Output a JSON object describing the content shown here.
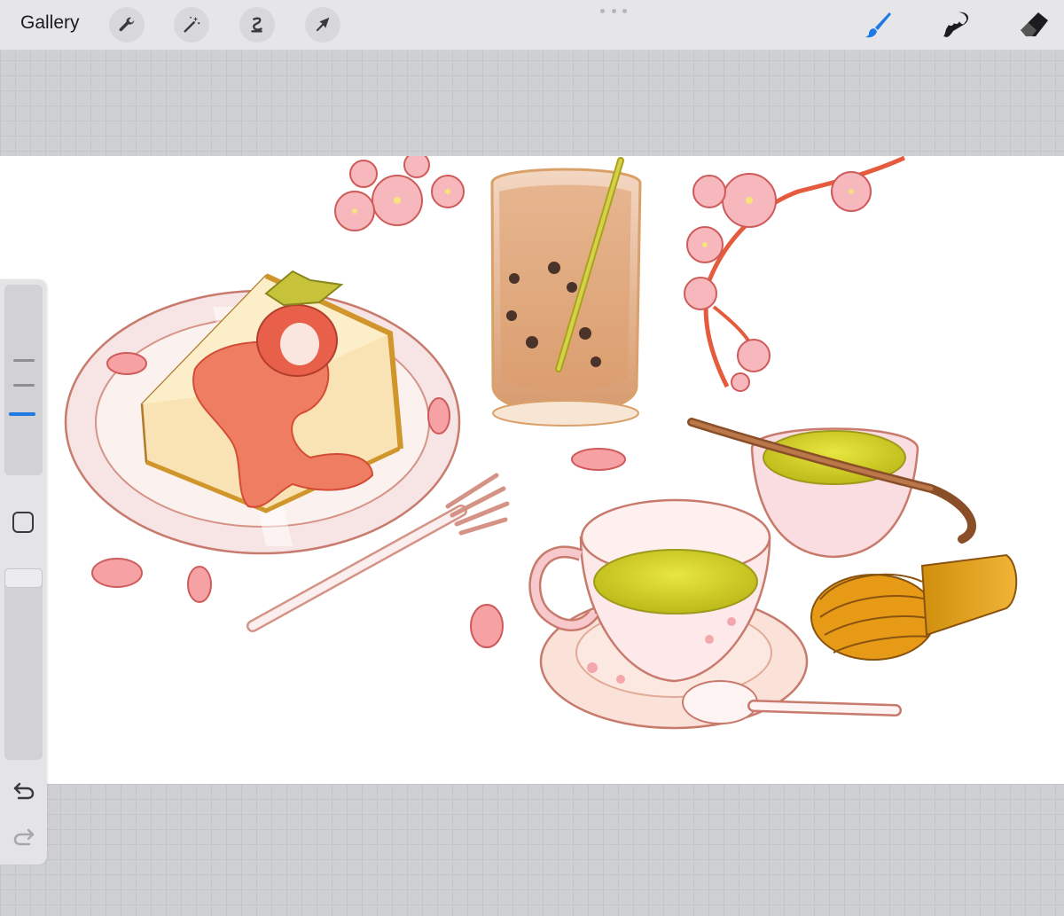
{
  "toolbar": {
    "gallery_label": "Gallery",
    "left_tools": [
      "wrench-icon",
      "magic-wand-icon",
      "selection-icon",
      "transform-arrow-icon"
    ],
    "right_tools": [
      "brush-icon",
      "smudge-icon",
      "eraser-icon"
    ],
    "active_tool": "brush",
    "accent_color": "#1f7ae6"
  },
  "sidebar": {
    "brush_size_level": 0.3,
    "opacity_level": 1.0,
    "buttons": [
      "modify-button",
      "undo-icon",
      "redo-icon"
    ]
  },
  "canvas": {
    "background": "#ffffff",
    "palette": {
      "blossom": "#f4a7ad",
      "sauce": "#e8604a",
      "matcha": "#c9cb23",
      "tea_drink": "#d49a6a",
      "wood": "#a8673b"
    }
  }
}
